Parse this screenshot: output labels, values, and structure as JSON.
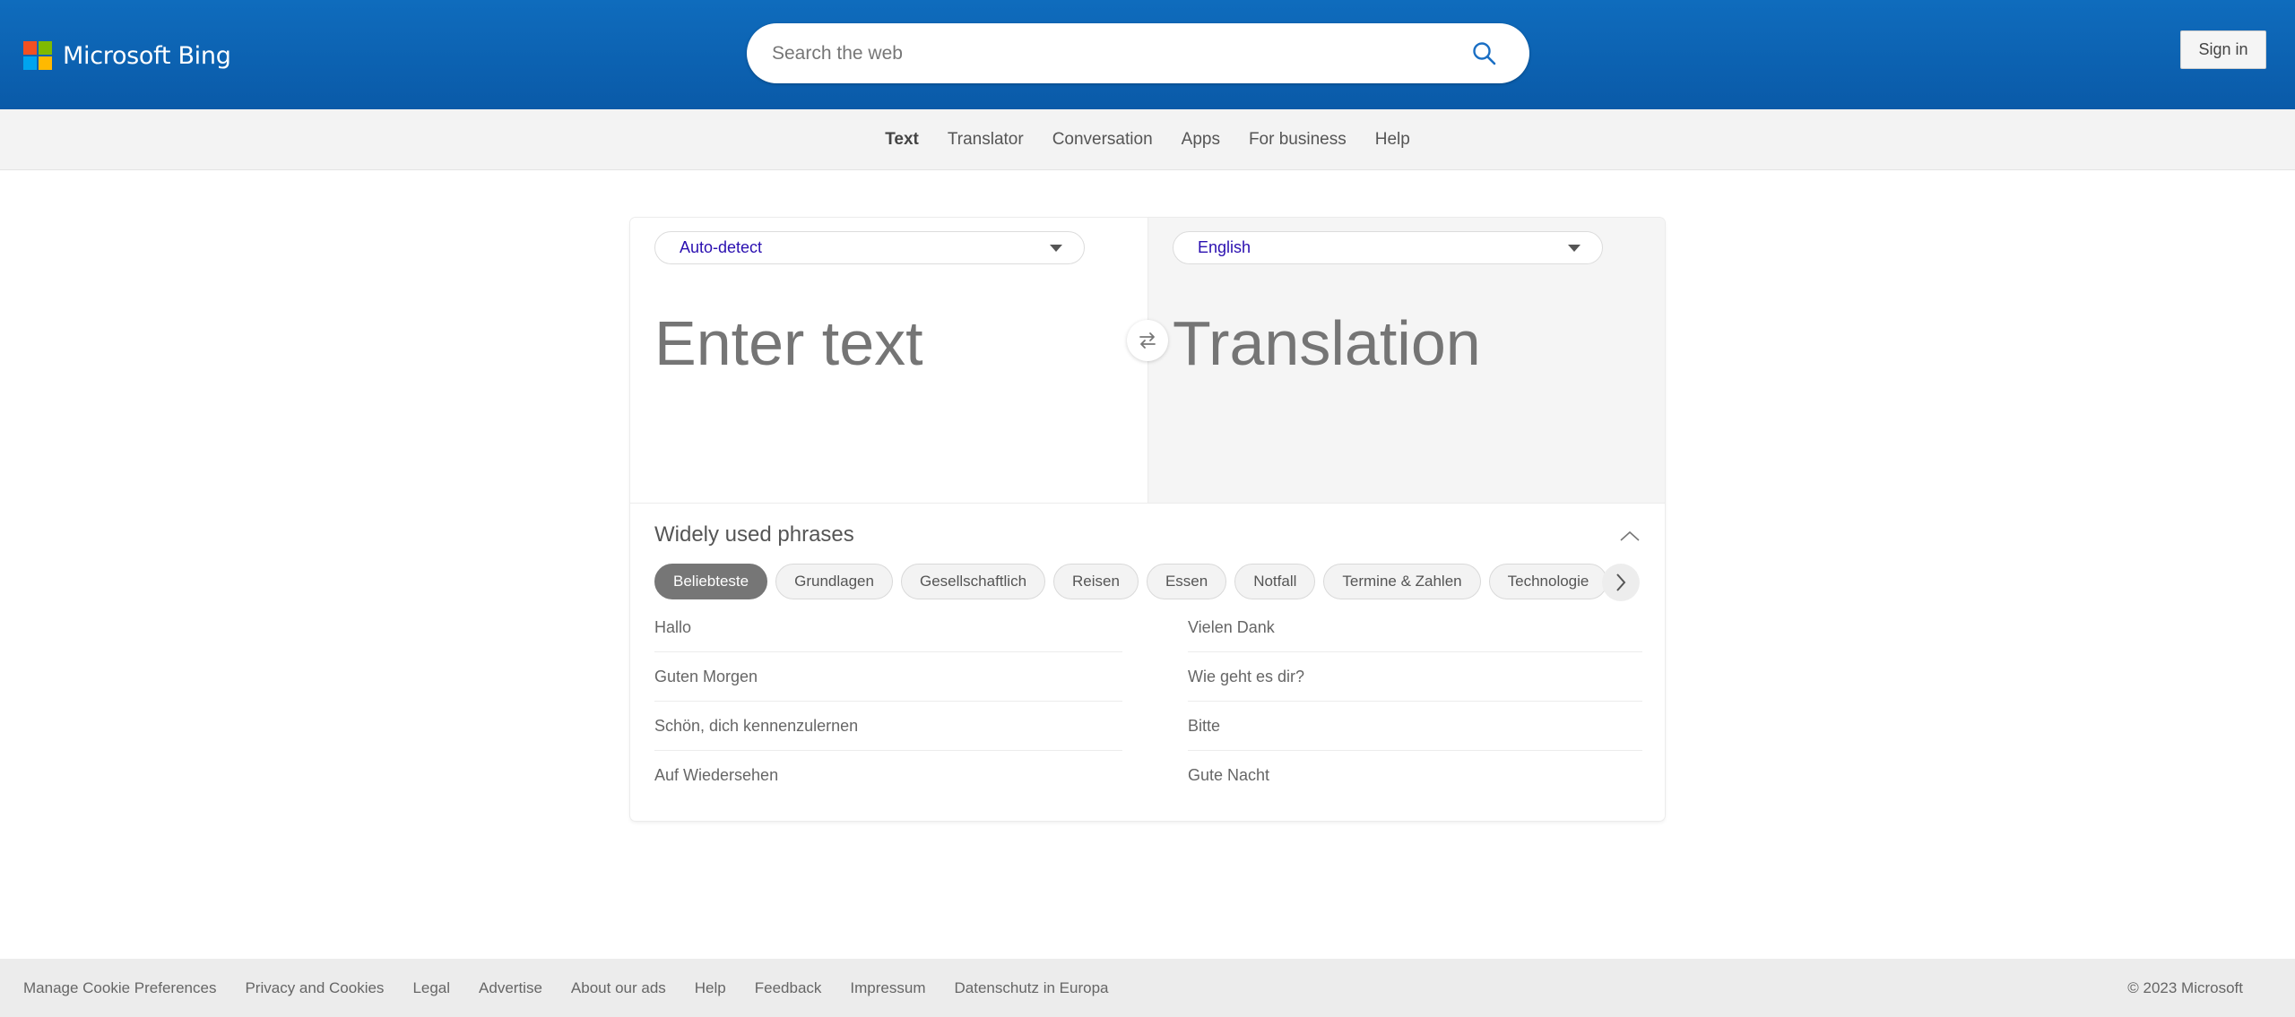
{
  "header": {
    "logo_text": "Microsoft Bing",
    "logo_colors": [
      "#f25022",
      "#7fba00",
      "#00a4ef",
      "#ffb900"
    ],
    "search_placeholder": "Search the web",
    "search_icon": "search-icon",
    "sign_in_label": "Sign in"
  },
  "subnav": {
    "items": [
      {
        "label": "Text",
        "active": true
      },
      {
        "label": "Translator",
        "active": false
      },
      {
        "label": "Conversation",
        "active": false
      },
      {
        "label": "Apps",
        "active": false
      },
      {
        "label": "For business",
        "active": false
      },
      {
        "label": "Help",
        "active": false
      }
    ]
  },
  "translator": {
    "source_language": "Auto-detect",
    "target_language": "English",
    "input_placeholder": "Enter text",
    "output_placeholder": "Translation",
    "swap_icon": "swap-arrows-icon"
  },
  "phrases": {
    "title": "Widely used phrases",
    "categories": [
      {
        "label": "Beliebteste",
        "active": true
      },
      {
        "label": "Grundlagen",
        "active": false
      },
      {
        "label": "Gesellschaftlich",
        "active": false
      },
      {
        "label": "Reisen",
        "active": false
      },
      {
        "label": "Essen",
        "active": false
      },
      {
        "label": "Notfall",
        "active": false
      },
      {
        "label": "Termine & Zahlen",
        "active": false
      },
      {
        "label": "Technologie",
        "active": false
      }
    ],
    "left_column": [
      "Hallo",
      "Guten Morgen",
      "Schön, dich kennenzulernen",
      "Auf Wiedersehen"
    ],
    "right_column": [
      "Vielen Dank",
      "Wie geht es dir?",
      "Bitte",
      "Gute Nacht"
    ]
  },
  "footer": {
    "links": [
      "Manage Cookie Preferences",
      "Privacy and Cookies",
      "Legal",
      "Advertise",
      "About our ads",
      "Help",
      "Feedback",
      "Impressum",
      "Datenschutz in Europa"
    ],
    "copyright": "© 2023 Microsoft"
  },
  "colors": {
    "header_blue": "#0f6cbd",
    "language_label": "#2a0fb0",
    "active_chip": "#767676"
  }
}
